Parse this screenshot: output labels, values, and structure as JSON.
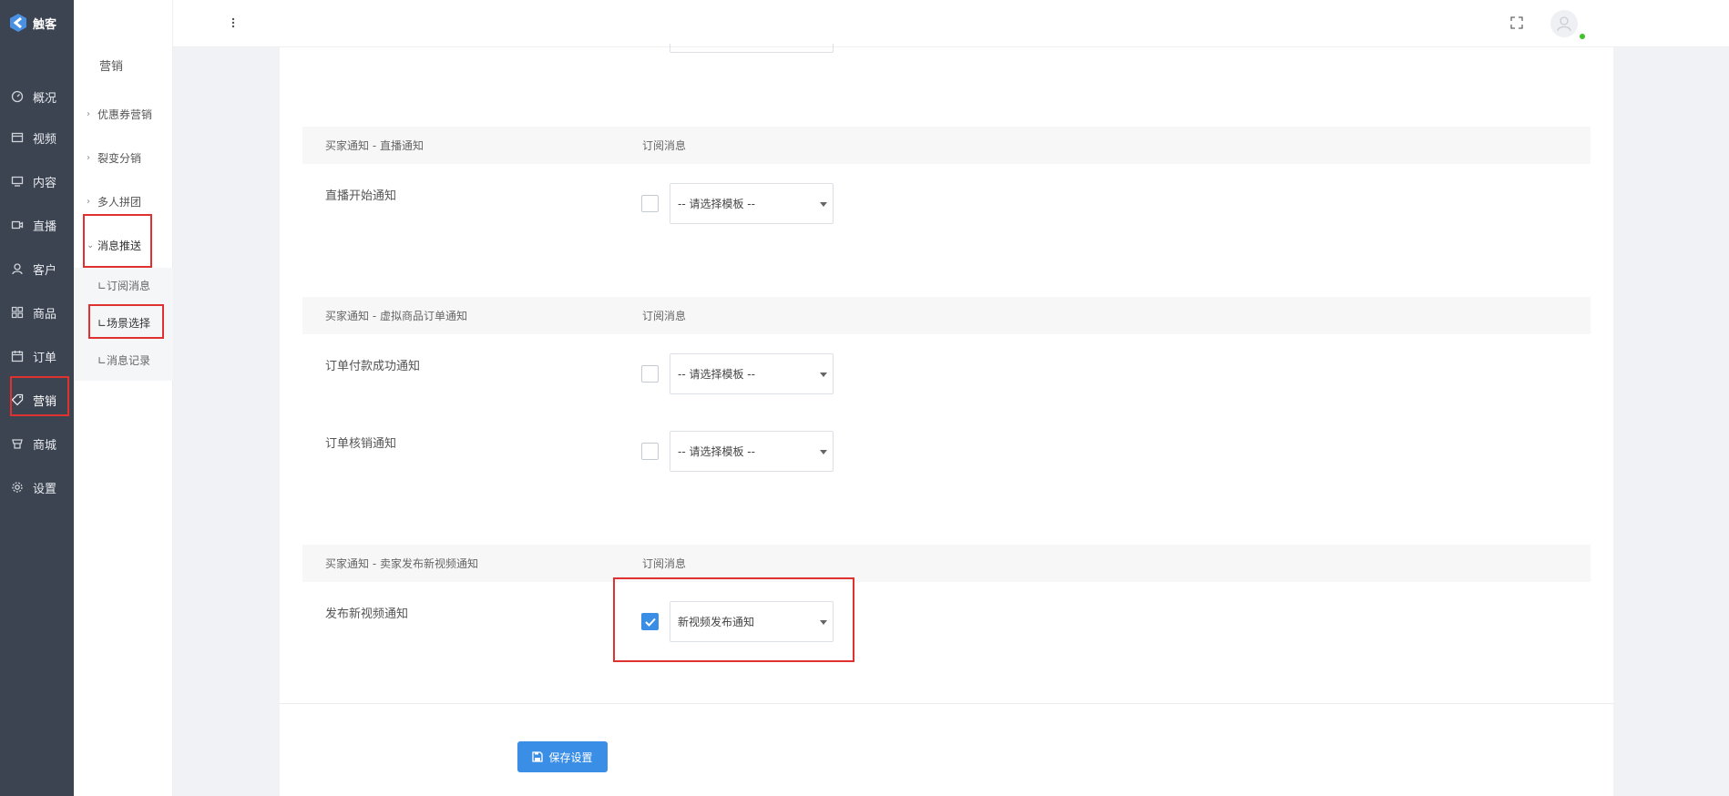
{
  "app": {
    "name": "触客"
  },
  "rail": {
    "items": [
      {
        "label": "概况",
        "icon": "dashboard-icon"
      },
      {
        "label": "视频",
        "icon": "video-icon"
      },
      {
        "label": "内容",
        "icon": "monitor-icon"
      },
      {
        "label": "直播",
        "icon": "camera-icon"
      },
      {
        "label": "客户",
        "icon": "user-icon"
      },
      {
        "label": "商品",
        "icon": "grid-icon"
      },
      {
        "label": "订单",
        "icon": "calendar-icon"
      },
      {
        "label": "营销",
        "icon": "tag-icon"
      },
      {
        "label": "商城",
        "icon": "store-icon"
      },
      {
        "label": "设置",
        "icon": "gear-icon"
      }
    ],
    "active": "营销"
  },
  "submenu": {
    "title": "营销",
    "items": [
      {
        "label": "优惠券营销"
      },
      {
        "label": "裂变分销"
      },
      {
        "label": "多人拼团"
      },
      {
        "label": "消息推送"
      }
    ],
    "children": [
      {
        "label": "∟订阅消息"
      },
      {
        "label": "∟场景选择"
      },
      {
        "label": "∟消息记录"
      }
    ]
  },
  "sections": [
    {
      "title": "买家通知 - 直播通知",
      "type_label": "订阅消息",
      "rows": [
        {
          "label": "直播开始通知",
          "checked": false,
          "template": "-- 请选择模板 --"
        }
      ]
    },
    {
      "title": "买家通知 - 虚拟商品订单通知",
      "type_label": "订阅消息",
      "rows": [
        {
          "label": "订单付款成功通知",
          "checked": false,
          "template": "-- 请选择模板 --"
        },
        {
          "label": "订单核销通知",
          "checked": false,
          "template": "-- 请选择模板 --"
        }
      ]
    },
    {
      "title": "买家通知 - 卖家发布新视频通知",
      "type_label": "订阅消息",
      "rows": [
        {
          "label": "发布新视频通知",
          "checked": true,
          "template": "新视频发布通知"
        }
      ]
    }
  ],
  "save_button": {
    "label": "保存设置",
    "icon": "save-icon"
  },
  "colors": {
    "rail_bg": "#3d4451",
    "primary": "#3a8ee6",
    "annotation": "#e03131",
    "online": "#44c02e"
  }
}
